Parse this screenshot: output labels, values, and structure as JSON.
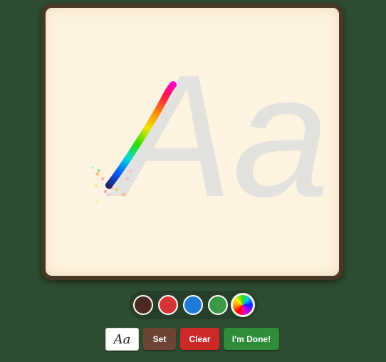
{
  "canvas": {
    "guide_text": "Aa",
    "guide_color": "#e2e2de",
    "board_color": "#fdf3e1",
    "frame_color": "#4a3826"
  },
  "palette": {
    "colors": [
      {
        "name": "brown",
        "hex": "#4a2a22",
        "selected": false
      },
      {
        "name": "red",
        "hex": "#d7343a",
        "selected": false
      },
      {
        "name": "blue",
        "hex": "#1f7ad8",
        "selected": false
      },
      {
        "name": "green",
        "hex": "#3a9a48",
        "selected": false
      },
      {
        "name": "rainbow",
        "hex": "rainbow",
        "selected": true
      }
    ]
  },
  "toolbar": {
    "guide_label": "Aa",
    "set_label": "Set",
    "clear_label": "Clear",
    "done_label": "I'm Done!"
  }
}
